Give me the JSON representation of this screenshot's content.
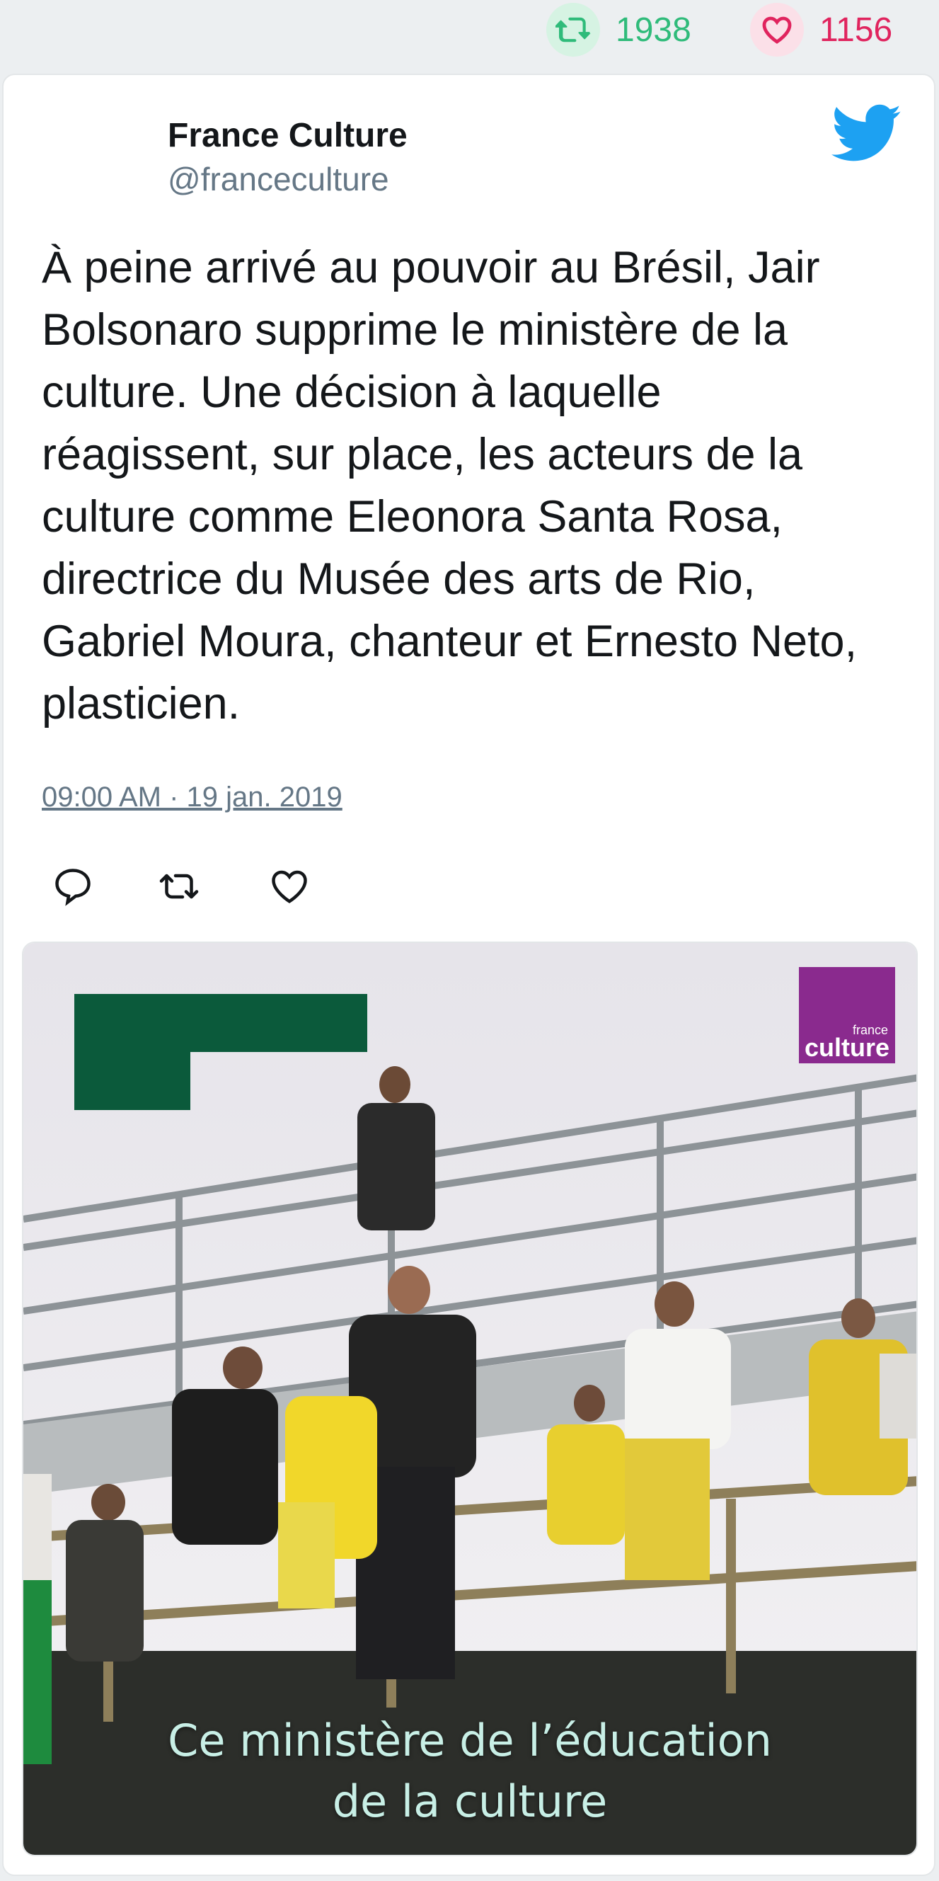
{
  "stats": {
    "retweets": "1938",
    "likes": "1156"
  },
  "tweet": {
    "author_name": "France Culture",
    "author_handle": "@franceculture",
    "text": "À peine arrivé au pouvoir au Brésil, Jair Bolsonaro supprime le ministère de la culture. Une décision à laquelle réagissent, sur place, les acteurs de la culture comme Eleonora Santa Rosa, directrice du Musée des arts de Rio, Gabriel Moura, chanteur et Ernesto Neto, plasticien.",
    "timestamp": "09:00 AM · 19 jan. 2019"
  },
  "icons": {
    "retweet": "retweet-icon",
    "like": "heart-icon",
    "twitter": "twitter-bird-icon",
    "reply": "reply-icon"
  },
  "media": {
    "caption_line1": "Ce ministère de l’éducation",
    "caption_line2": "de la culture",
    "logo_small": "france",
    "logo_big": "culture"
  },
  "colors": {
    "retweet": "#2fbb7a",
    "like": "#e0245e",
    "twitter_blue": "#1da1f2",
    "logo_purple": "#8a2a8e",
    "green_block": "#0b5a3b"
  }
}
